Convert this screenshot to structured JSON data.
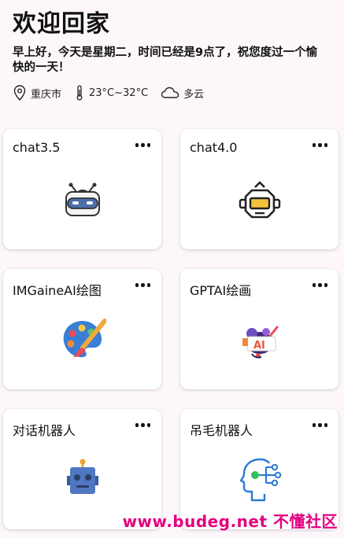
{
  "header": {
    "title": "欢迎回家",
    "greeting": "早上好，今天是星期二，时间已经是9点了，祝您度过一个愉快的一天！",
    "location": "重庆市",
    "temperature": "23°C~32°C",
    "weather": "多云"
  },
  "cards": [
    {
      "title": "chat3.5",
      "icon": "robot-icon"
    },
    {
      "title": "chat4.0",
      "icon": "robot-head-icon"
    },
    {
      "title": "IMGaineAI绘图",
      "icon": "palette-icon"
    },
    {
      "title": "GPTAI绘画",
      "icon": "ai-painting-icon"
    },
    {
      "title": "对话机器人",
      "icon": "chat-robot-icon"
    },
    {
      "title": "吊毛机器人",
      "icon": "ai-brain-icon"
    }
  ],
  "watermark": "www.budeg.net 不懂社区"
}
